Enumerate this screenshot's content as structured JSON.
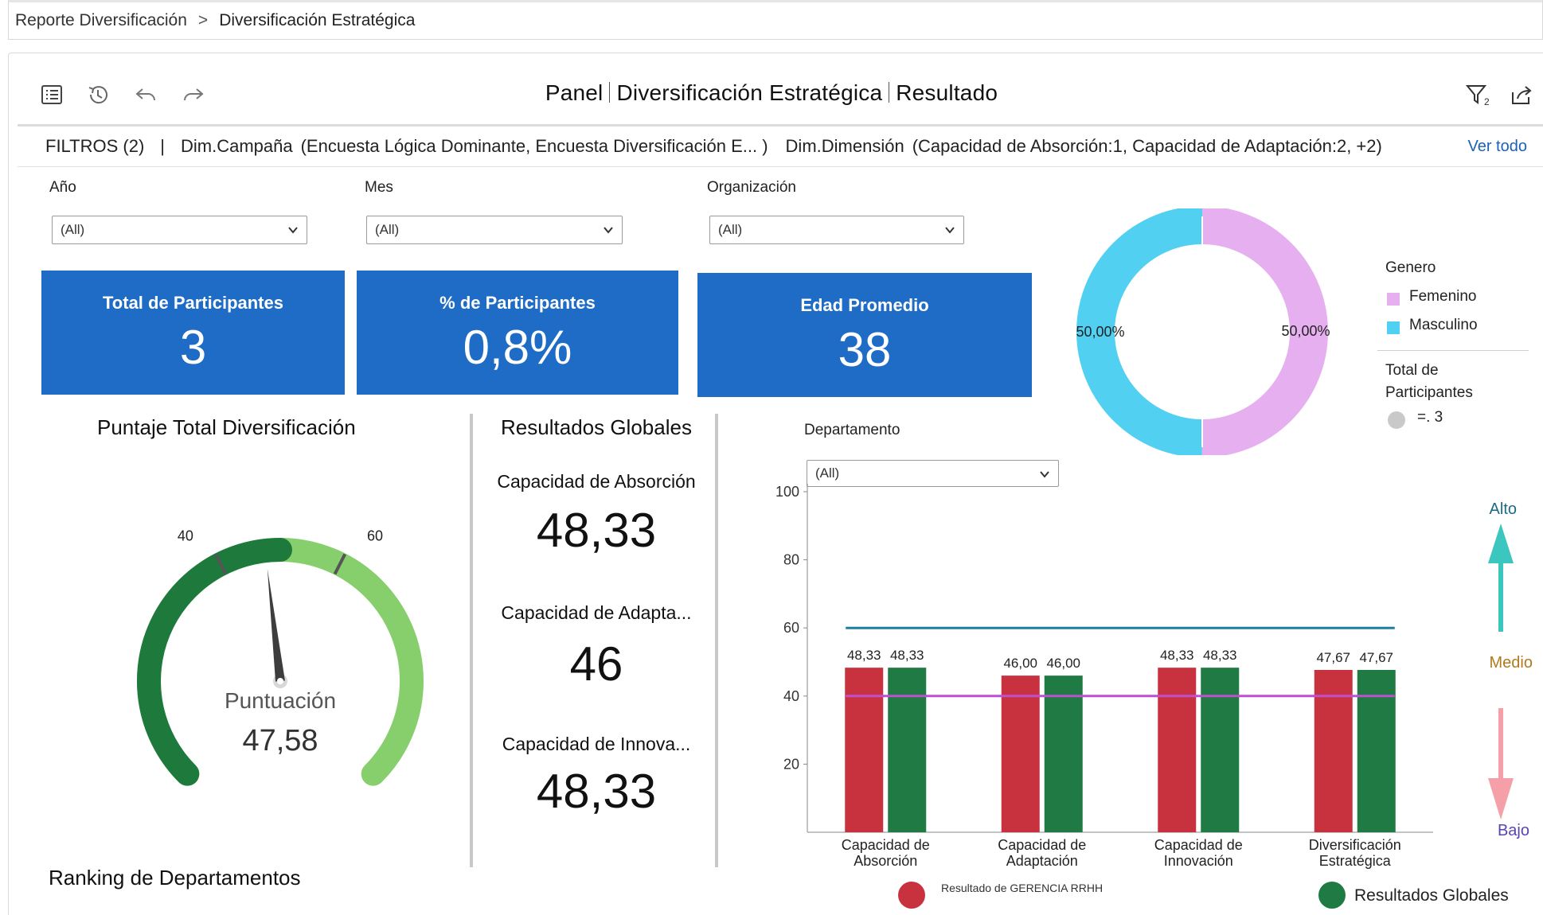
{
  "breadcrumb": {
    "parent": "Reporte Diversificación",
    "separator": ">",
    "current": "Diversificación Estratégica"
  },
  "toolbar": {
    "icons": [
      "list-icon",
      "history-icon",
      "undo-icon",
      "redo-icon",
      "filter-icon",
      "share-icon"
    ],
    "filter_badge": "2"
  },
  "panel_title": {
    "part1": "Panel",
    "part2": "Diversificación Estratégica",
    "part3": "Resultado"
  },
  "filters": {
    "count_label": "FILTROS (2)",
    "pipe": "|",
    "campaign_dim": "Dim.Campaña",
    "campaign_values": "(Encuesta Lógica Dominante, Encuesta Diversificación E... )",
    "dimension_dim": "Dim.Dimensión",
    "dimension_values": "(Capacidad de Absorción:1, Capacidad de Adaptación:2, +2)",
    "view_all": "Ver todo"
  },
  "selectors": {
    "year": {
      "label": "Año",
      "value": "(All)"
    },
    "month": {
      "label": "Mes",
      "value": "(All)"
    },
    "organization": {
      "label": "Organización",
      "value": "(All)"
    },
    "department": {
      "label": "Departamento",
      "value": "(All)"
    }
  },
  "kpis": [
    {
      "label": "Total de Participantes",
      "value": "3"
    },
    {
      "label": "% de Participantes",
      "value": "0,8%"
    },
    {
      "label": "Edad Promedio",
      "value": "38"
    }
  ],
  "colors": {
    "kpi_blue": "#1f6cc6",
    "femenino": "#e6b0f0",
    "masculino": "#52d0f2",
    "red_bar": "#c8323f",
    "green_bar": "#1f7a43",
    "gauge_dark": "#1e7a3c",
    "gauge_light": "#86cf6c"
  },
  "gender_chart": {
    "legend_title": "Genero",
    "items": [
      {
        "name": "Femenino",
        "value": 50,
        "label": "50,00%"
      },
      {
        "name": "Masculino",
        "value": 50,
        "label": "50,00%"
      }
    ],
    "total_label": "Total de Participantes",
    "total_value": "=. 3"
  },
  "gauge": {
    "title": "Puntaje Total Diversificación",
    "label": "Puntuación",
    "value_text": "47,58",
    "value": 47.58,
    "min": 0,
    "max": 100,
    "tick_low": "40",
    "tick_high": "60"
  },
  "global_results": {
    "title": "Resultados Globales",
    "metrics": [
      {
        "label": "Capacidad de Absorción",
        "value": "48,33"
      },
      {
        "label": "Capacidad de Adapta...",
        "value": "46"
      },
      {
        "label": "Capacidad de Innova...",
        "value": "48,33"
      }
    ]
  },
  "ranking": {
    "title": "Ranking de Departamentos"
  },
  "chart_data": {
    "type": "bar",
    "title": "",
    "categories": [
      [
        "Capacidad de",
        "Absorción"
      ],
      [
        "Capacidad de",
        "Adaptación"
      ],
      [
        "Capacidad de",
        "Innovación"
      ],
      [
        "Diversificación",
        "Estratégica"
      ]
    ],
    "series": [
      {
        "name": "Resultado de GERENCIA RRHH",
        "values": [
          48.33,
          46.0,
          48.33,
          47.67
        ],
        "labels": [
          "48,33",
          "46,00",
          "48,33",
          "47,67"
        ]
      },
      {
        "name": "Resultados Globales",
        "values": [
          48.33,
          46.0,
          48.33,
          47.67
        ],
        "labels": [
          "48,33",
          "46,00",
          "48,33",
          "47,67"
        ]
      }
    ],
    "reference_lines": [
      {
        "value": 60,
        "color": "#1a7fa0"
      },
      {
        "value": 40,
        "color": "#c04fd0"
      }
    ],
    "ylim": [
      0,
      100
    ],
    "yticks": [
      20,
      40,
      60,
      80,
      100
    ],
    "grid": false,
    "legend_position": "bottom",
    "scale_labels": {
      "high": "Alto",
      "mid": "Medio",
      "low": "Bajo"
    }
  }
}
